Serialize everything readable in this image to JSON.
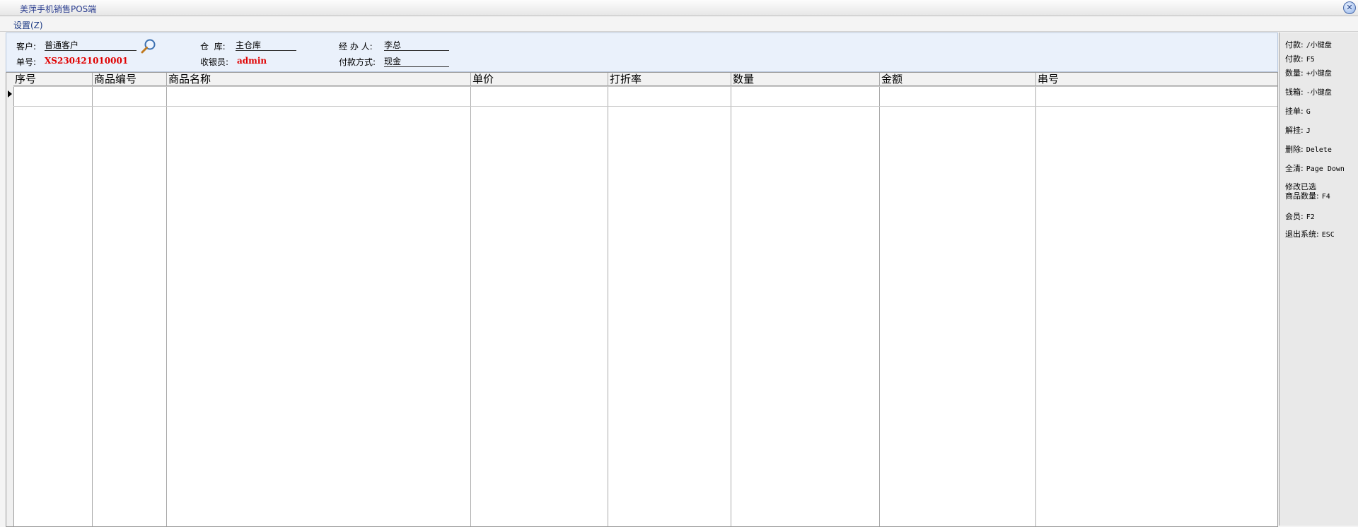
{
  "window": {
    "title": "美萍手机销售POS端",
    "close_icon": "close-icon"
  },
  "menu": {
    "settings": "设置(Z)"
  },
  "form": {
    "customer_label": "客户:",
    "customer_value": "普通客户",
    "order_label": "单号:",
    "order_value": "XS230421010001",
    "warehouse_label": "仓  库:",
    "warehouse_value": "主仓库",
    "cashier_label": "收银员:",
    "cashier_value": "admin",
    "handler_label": "经 办 人:",
    "handler_value": "李总",
    "payment_label": "付款方式:",
    "payment_value": "现金"
  },
  "table": {
    "columns": [
      "序号",
      "商品编号",
      "商品名称",
      "单价",
      "打折率",
      "数量",
      "金额",
      "串号"
    ]
  },
  "shortcuts": [
    {
      "label": "付款:",
      "key": "/小键盘"
    },
    {
      "label": "付款:",
      "key": "F5"
    },
    {
      "label": "数量:",
      "key": "+小键盘"
    },
    {
      "label": "钱箱:",
      "key": "-小键盘"
    },
    {
      "label": "挂单:",
      "key": "G"
    },
    {
      "label": "解挂:",
      "key": "J"
    },
    {
      "label": "删除:",
      "key": "Delete"
    },
    {
      "label": "全清:",
      "key": "Page Down"
    },
    {
      "label": "修改已选",
      "key": ""
    },
    {
      "label": "商品数量:",
      "key": "F4"
    },
    {
      "label": "会员:",
      "key": "F2"
    },
    {
      "label": "退出系统:",
      "key": "ESC"
    }
  ],
  "colors": {
    "accent_red": "#e00000",
    "panel_bg": "#eaf1fb"
  }
}
